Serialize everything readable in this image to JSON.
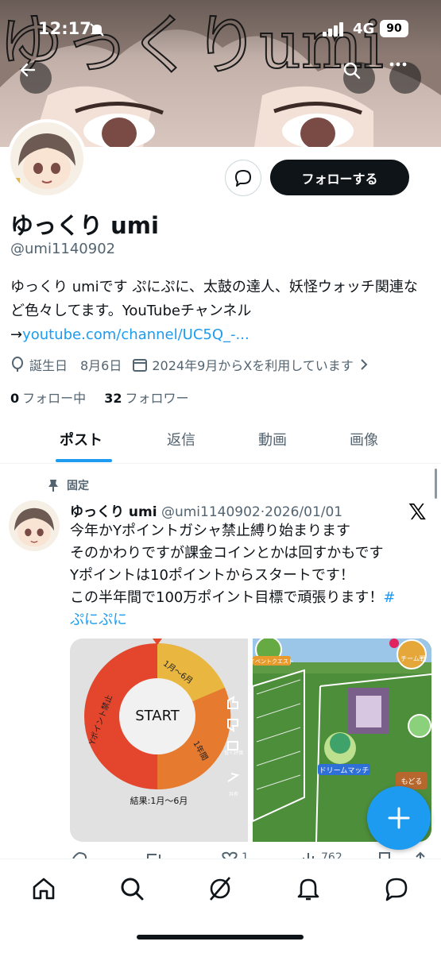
{
  "status_bar": {
    "time": "12:17",
    "network": "4G",
    "battery": "90"
  },
  "banner": {
    "text": "ゆっくりumi"
  },
  "profile": {
    "name": "ゆっくり umi",
    "handle": "@umi1140902",
    "bio": "ゆっくり umiです ぷにぷに、太鼓の達人、妖怪ウォッチ関連など色々してます。YouTubeチャンネル",
    "bio_arrow": "→",
    "bio_link": "youtube.com/channel/UC5Q_-...",
    "birthday": "誕生日　8月6日",
    "joined": "2024年9月からXを利用しています",
    "following_count": "0",
    "following_label": "フォロー中",
    "followers_count": "32",
    "followers_label": "フォロワー",
    "follow_button": "フォローする"
  },
  "tabs": [
    "ポスト",
    "返信",
    "動画",
    "画像"
  ],
  "post": {
    "pinned_label": "固定",
    "author": "ゆっくり umi",
    "handle_date": "@umi1140902·2026/01/01",
    "lines": [
      "今年かYポイントガシャ禁止縛り始まります",
      "そのかわりですが課金コインとかは回すかもです",
      "Yポイントは10ポイントからスタートです！",
      "この半年間で100万ポイント目標で頑張ります！"
    ],
    "hashtag_part1": "#",
    "hashtag_part2": "ぷにぷに",
    "media1": {
      "center": "START",
      "result": "結果:1月～6月",
      "seg1": "1月～6月",
      "seg2": "1年間",
      "seg3": "Yポイント禁止",
      "side_labels": [
        "低く評価",
        "共有"
      ]
    },
    "media2": {
      "badge1": "イベントクエスト",
      "badge2": "チーム戦",
      "badge3": "ドリームマッチ",
      "badge4": "もどる"
    },
    "action_counts": [
      "1",
      "762"
    ]
  },
  "colors": {
    "accent": "#1d9bf0",
    "text": "#0f1419",
    "muted": "#536471"
  }
}
